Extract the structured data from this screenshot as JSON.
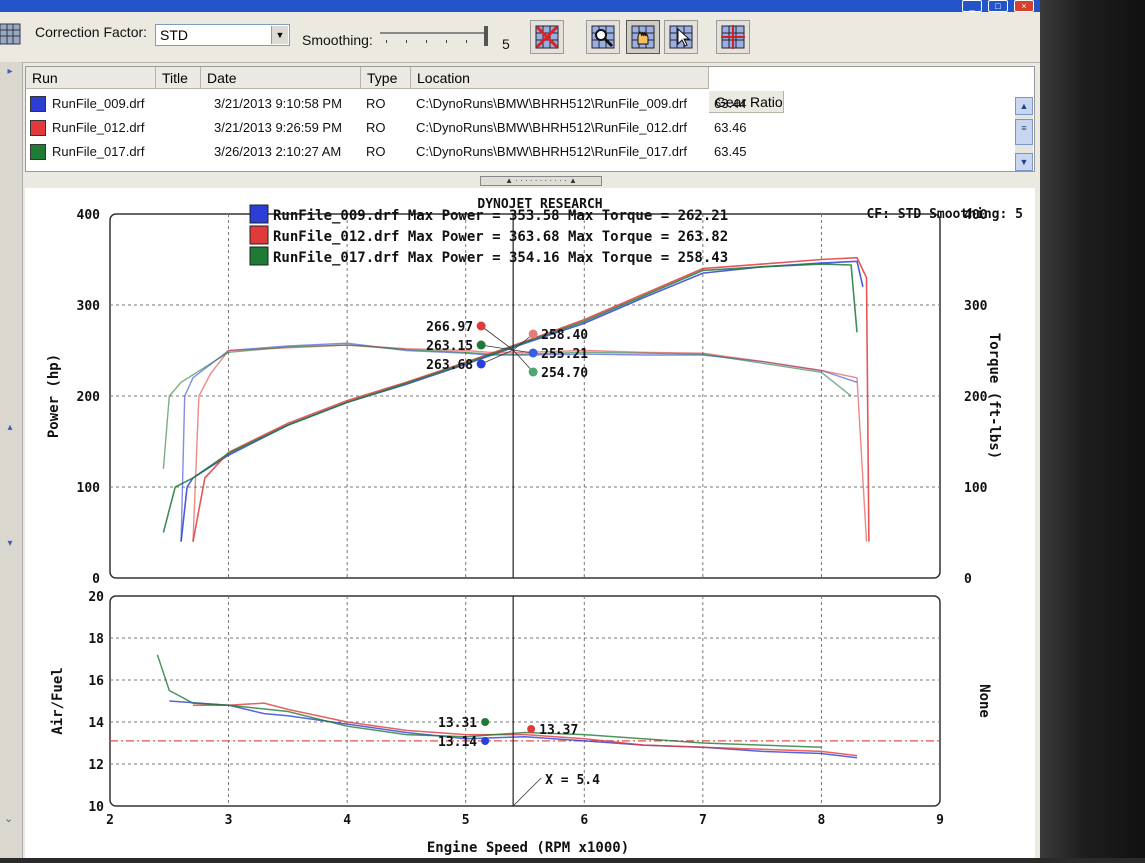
{
  "toolbar": {
    "correction_label": "Correction Factor:",
    "correction_value": "STD",
    "smoothing_label": "Smoothing:",
    "smoothing_value": "5",
    "tools": [
      "delete-graph-icon",
      "zoom-icon",
      "pan-hand-icon",
      "cursor-icon",
      "grid-icon"
    ]
  },
  "table": {
    "columns": [
      "Run",
      "Title",
      "Date",
      "Type",
      "Location",
      "Gear Ratio"
    ],
    "rows": [
      {
        "run": "RunFile_009.drf",
        "date": "3/21/2013 9:10:58 PM",
        "type": "RO",
        "location": "C:\\DynoRuns\\BMW\\BHRH512\\RunFile_009.drf",
        "gear": "63.44",
        "color": "#2b3fd6"
      },
      {
        "run": "RunFile_012.drf",
        "date": "3/21/2013 9:26:59 PM",
        "type": "RO",
        "location": "C:\\DynoRuns\\BMW\\BHRH512\\RunFile_012.drf",
        "gear": "63.46",
        "color": "#e03a3a"
      },
      {
        "run": "RunFile_017.drf",
        "date": "3/26/2013 2:10:27 AM",
        "type": "RO",
        "location": "C:\\DynoRuns\\BMW\\BHRH512\\RunFile_017.drf",
        "gear": "63.45",
        "color": "#1f7a35"
      }
    ]
  },
  "chart_data": [
    {
      "type": "line",
      "title": "DYNOJET RESEARCH",
      "annotation_right": "CF: STD  Smoothing: 5",
      "xlabel": "",
      "ylabel": "Power (hp)",
      "ylabel_right": "Torque (ft-lbs)",
      "xlim": [
        2,
        9
      ],
      "ylim": [
        0,
        400
      ],
      "ylim_right": [
        0,
        400
      ],
      "y_ticks": [
        "0",
        "100",
        "200",
        "300",
        "400"
      ],
      "y_ticks_right": [
        "0",
        "100",
        "200",
        "300",
        "400"
      ],
      "grid": true,
      "legend": [
        {
          "label": "RunFile_009.drf Max Power = 353.58 Max Torque = 262.21",
          "color": "#2b3fd6"
        },
        {
          "label": "RunFile_012.drf Max Power = 363.68 Max Torque = 263.82",
          "color": "#e03a3a"
        },
        {
          "label": "RunFile_017.drf Max Power = 354.16 Max Torque = 258.43",
          "color": "#1f7a35"
        }
      ],
      "cursor_x": 5.4,
      "series": [
        {
          "name": "RunFile_009.drf",
          "color": "#2b3fd6",
          "power": [
            [
              2.6,
              40
            ],
            [
              2.65,
              100
            ],
            [
              2.7,
              110
            ],
            [
              3,
              135
            ],
            [
              3.5,
              168
            ],
            [
              4,
              193
            ],
            [
              4.5,
              213
            ],
            [
              5,
              235
            ],
            [
              5.5,
              258
            ],
            [
              6,
              280
            ],
            [
              6.5,
              308
            ],
            [
              7,
              335
            ],
            [
              7.5,
              342
            ],
            [
              8,
              346
            ],
            [
              8.3,
              348
            ],
            [
              8.35,
              320
            ]
          ],
          "torque": [
            [
              2.6,
              40
            ],
            [
              2.63,
              200
            ],
            [
              2.7,
              220
            ],
            [
              3,
              250
            ],
            [
              3.5,
              255
            ],
            [
              4,
              258
            ],
            [
              4.5,
              250
            ],
            [
              5,
              247
            ],
            [
              5.2,
              245
            ],
            [
              5.5,
              245
            ],
            [
              6,
              246
            ],
            [
              6.5,
              245
            ],
            [
              7,
              245
            ],
            [
              7.5,
              238
            ],
            [
              8,
              228
            ],
            [
              8.3,
              215
            ]
          ]
        },
        {
          "name": "RunFile_012.drf",
          "color": "#e03a3a",
          "power": [
            [
              2.7,
              40
            ],
            [
              2.8,
              110
            ],
            [
              3,
              138
            ],
            [
              3.5,
              170
            ],
            [
              4,
              195
            ],
            [
              4.5,
              215
            ],
            [
              5,
              237
            ],
            [
              5.5,
              260
            ],
            [
              6,
              284
            ],
            [
              6.5,
              312
            ],
            [
              7,
              340
            ],
            [
              7.5,
              345
            ],
            [
              8,
              350
            ],
            [
              8.3,
              352
            ],
            [
              8.38,
              330
            ],
            [
              8.4,
              40
            ]
          ],
          "torque": [
            [
              2.7,
              40
            ],
            [
              2.75,
              200
            ],
            [
              2.85,
              225
            ],
            [
              3,
              250
            ],
            [
              3.5,
              253
            ],
            [
              4,
              256
            ],
            [
              4.5,
              252
            ],
            [
              5,
              250
            ],
            [
              5.2,
              248
            ],
            [
              5.5,
              248
            ],
            [
              6,
              250
            ],
            [
              6.5,
              248
            ],
            [
              7,
              247
            ],
            [
              7.5,
              238
            ],
            [
              8,
              228
            ],
            [
              8.3,
              220
            ],
            [
              8.38,
              40
            ]
          ]
        },
        {
          "name": "RunFile_017.drf",
          "color": "#1f7a35",
          "power": [
            [
              2.45,
              50
            ],
            [
              2.55,
              100
            ],
            [
              2.7,
              110
            ],
            [
              3,
              137
            ],
            [
              3.5,
              168
            ],
            [
              4,
              193
            ],
            [
              4.5,
              214
            ],
            [
              5,
              236
            ],
            [
              5.5,
              259
            ],
            [
              6,
              282
            ],
            [
              6.5,
              310
            ],
            [
              7,
              338
            ],
            [
              7.5,
              342
            ],
            [
              8,
              345
            ],
            [
              8.25,
              344
            ],
            [
              8.3,
              270
            ]
          ],
          "torque": [
            [
              2.45,
              120
            ],
            [
              2.5,
              200
            ],
            [
              2.6,
              215
            ],
            [
              3,
              248
            ],
            [
              3.5,
              254
            ],
            [
              4,
              256
            ],
            [
              4.5,
              251
            ],
            [
              5,
              248
            ],
            [
              5.2,
              246
            ],
            [
              5.5,
              246
            ],
            [
              6,
              248
            ],
            [
              6.5,
              247
            ],
            [
              7,
              246
            ],
            [
              7.5,
              236
            ],
            [
              8,
              226
            ],
            [
              8.25,
              200
            ]
          ]
        }
      ],
      "cursor_labels": [
        "266.97",
        "263.15",
        "263.68",
        "258.40",
        "255.21",
        "254.70"
      ]
    },
    {
      "type": "line",
      "xlabel": "Engine Speed (RPM x1000)",
      "ylabel": "Air/Fuel",
      "ylabel_right": "None",
      "xlim": [
        2,
        9
      ],
      "ylim": [
        10,
        20
      ],
      "y_ticks": [
        "10",
        "12",
        "14",
        "16",
        "18",
        "20"
      ],
      "x_ticks": [
        "2",
        "3",
        "4",
        "5",
        "6",
        "7",
        "8",
        "9"
      ],
      "grid": true,
      "reference_line": 13.1,
      "cursor_x": 5.4,
      "cursor_label": "X = 5.4",
      "series": [
        {
          "name": "RunFile_009.drf",
          "color": "#2b3fd6",
          "values": [
            [
              2.5,
              15
            ],
            [
              3,
              14.8
            ],
            [
              3.3,
              14.4
            ],
            [
              3.5,
              14.3
            ],
            [
              4,
              13.9
            ],
            [
              4.5,
              13.5
            ],
            [
              5,
              13.2
            ],
            [
              5.5,
              13.3
            ],
            [
              6,
              13.1
            ],
            [
              6.5,
              12.9
            ],
            [
              7,
              12.8
            ],
            [
              7.5,
              12.6
            ],
            [
              8,
              12.5
            ],
            [
              8.3,
              12.3
            ]
          ]
        },
        {
          "name": "RunFile_012.drf",
          "color": "#e03a3a",
          "values": [
            [
              2.7,
              14.8
            ],
            [
              3,
              14.8
            ],
            [
              3.3,
              14.9
            ],
            [
              3.5,
              14.6
            ],
            [
              4,
              14.0
            ],
            [
              4.5,
              13.6
            ],
            [
              5,
              13.4
            ],
            [
              5.5,
              13.4
            ],
            [
              6,
              13.2
            ],
            [
              6.5,
              12.9
            ],
            [
              7,
              12.8
            ],
            [
              7.5,
              12.7
            ],
            [
              8,
              12.6
            ],
            [
              8.3,
              12.4
            ]
          ]
        },
        {
          "name": "RunFile_017.drf",
          "color": "#1f7a35",
          "values": [
            [
              2.4,
              17.2
            ],
            [
              2.5,
              15.5
            ],
            [
              2.7,
              14.9
            ],
            [
              3,
              14.8
            ],
            [
              3.5,
              14.5
            ],
            [
              4,
              13.8
            ],
            [
              4.5,
              13.4
            ],
            [
              5,
              13.3
            ],
            [
              5.5,
              13.5
            ],
            [
              6,
              13.4
            ],
            [
              6.5,
              13.2
            ],
            [
              7,
              13.0
            ],
            [
              7.5,
              12.9
            ],
            [
              8,
              12.8
            ]
          ]
        }
      ],
      "cursor_labels": [
        "13.31",
        "13.14",
        "13.37"
      ]
    }
  ]
}
